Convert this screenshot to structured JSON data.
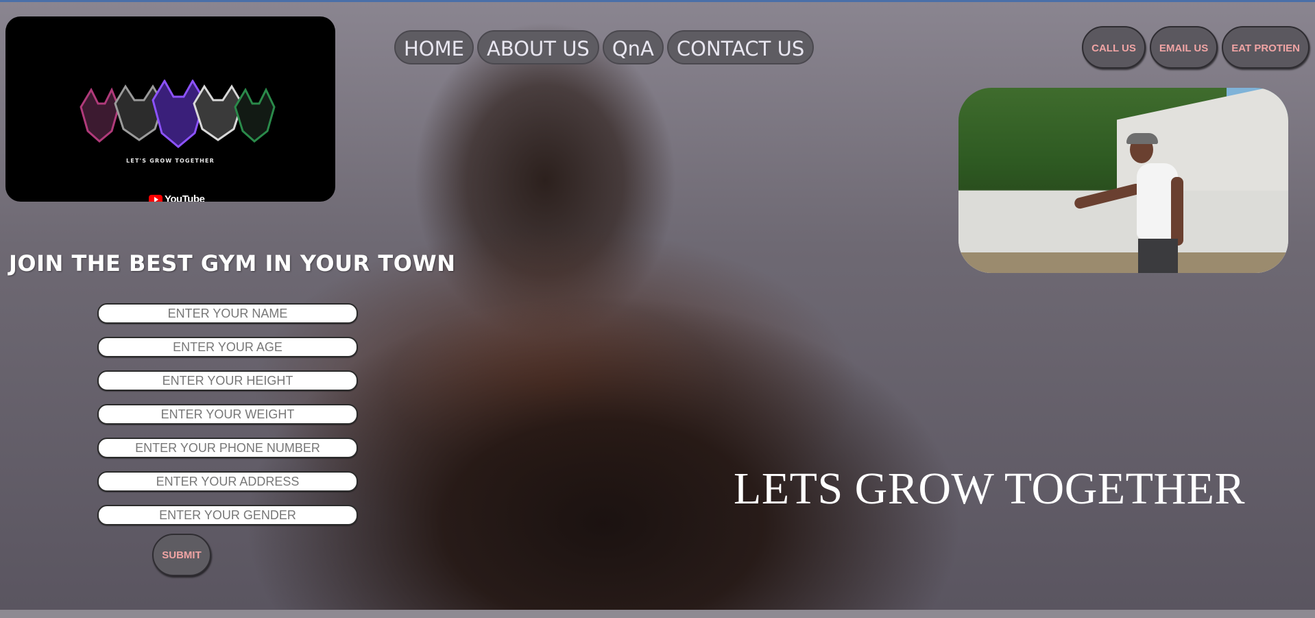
{
  "nav": {
    "items": [
      "HOME",
      "ABOUT US",
      "QnA",
      "CONTACT US"
    ]
  },
  "contact": {
    "items": [
      "CALL US",
      "EMAIL US",
      "EAT PROTIEN"
    ]
  },
  "video": {
    "tagline": "LET'S GROW TOGETHER",
    "platform": "YouTube"
  },
  "join": {
    "title": "JOIN THE BEST GYM IN YOUR TOWN",
    "fields": [
      "ENTER YOUR NAME",
      "ENTER YOUR AGE",
      "ENTER YOUR HEIGHT",
      "ENTER YOUR WEIGHT",
      "ENTER YOUR PHONE NUMBER",
      "ENTER YOUR ADDRESS",
      "ENTER YOUR GENDER"
    ],
    "submit": "SUBMIT"
  },
  "hero": {
    "slogan": "LETS GROW TOGETHER"
  },
  "colors": {
    "button_bg": "#5e5c62",
    "button_text_nav": "#e8e6f0",
    "button_text_contact": "#f0a4a4"
  }
}
